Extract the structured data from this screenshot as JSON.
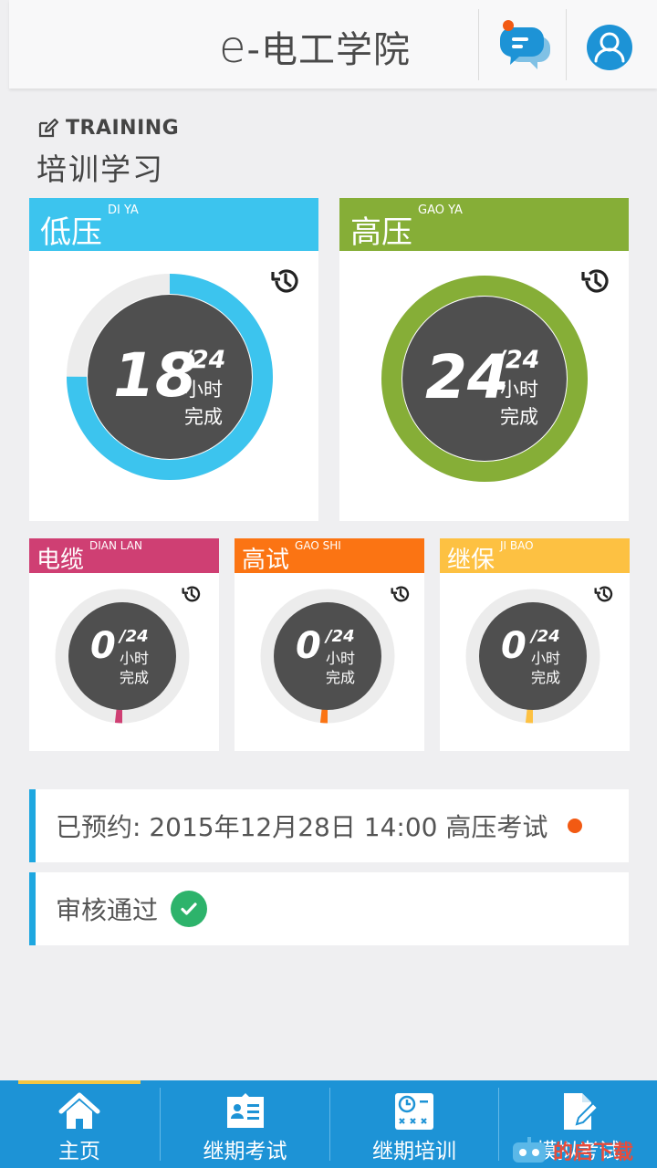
{
  "header": {
    "title_prefix": "e",
    "title_rest": "-电工学院"
  },
  "section": {
    "label_en": "TRAINING",
    "label_zh": "培训学习"
  },
  "big_cards": [
    {
      "name_zh": "低压",
      "name_en": "DI YA",
      "done": "18",
      "total": "/24",
      "unit": "小时",
      "status": "完成",
      "progress": 0.75,
      "color": "#3cc4ee"
    },
    {
      "name_zh": "高压",
      "name_en": "GAO YA",
      "done": "24",
      "total": "/24",
      "unit": "小时",
      "status": "完成",
      "progress": 1.0,
      "color": "#86ae37"
    }
  ],
  "small_cards": [
    {
      "name_zh": "电缆",
      "name_en": "DIAN LAN",
      "done": "0",
      "total": "/24",
      "unit": "小时",
      "status": "完成",
      "progress": 0.02,
      "color": "#cf3f73"
    },
    {
      "name_zh": "高试",
      "name_en": "GAO SHI",
      "done": "0",
      "total": "/24",
      "unit": "小时",
      "status": "完成",
      "progress": 0.02,
      "color": "#fb7413"
    },
    {
      "name_zh": "继保",
      "name_en": "JI BAO",
      "done": "0",
      "total": "/24",
      "unit": "小时",
      "status": "完成",
      "progress": 0.02,
      "color": "#fdc142"
    }
  ],
  "notices": {
    "booking": "已预约: 2015年12月28日 14:00  高压考试",
    "audit": "审核通过"
  },
  "tabs": [
    {
      "label": "主页",
      "icon": "home-icon"
    },
    {
      "label": "继期考试",
      "icon": "exam-icon"
    },
    {
      "label": "继期培训",
      "icon": "training-icon"
    },
    {
      "label": "模拟考试",
      "icon": "document-edit-icon"
    }
  ],
  "watermark": {
    "text": "的启下载"
  }
}
